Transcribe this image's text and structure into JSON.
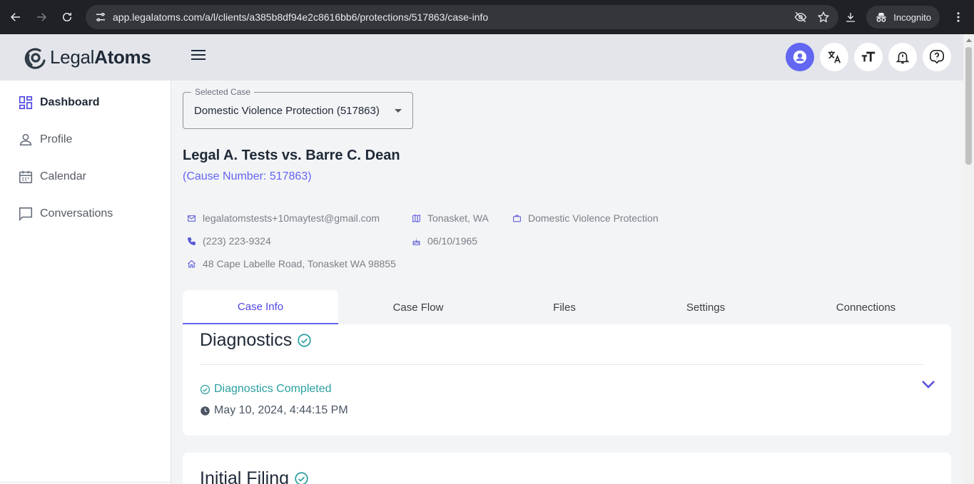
{
  "browser": {
    "url": "app.legalatoms.com/a/l/clients/a385b8df94e2c8616bb6/protections/517863/case-info",
    "incognito_label": "Incognito"
  },
  "sidebar": {
    "logo_prefix": "Legal",
    "logo_suffix": "Atoms",
    "items": [
      {
        "label": "Dashboard",
        "icon": "dashboard-icon",
        "active": true
      },
      {
        "label": "Profile",
        "icon": "person-icon",
        "active": false
      },
      {
        "label": "Calendar",
        "icon": "calendar-icon",
        "active": false
      },
      {
        "label": "Conversations",
        "icon": "chat-icon",
        "active": false
      }
    ]
  },
  "appbar": {
    "icons": [
      "account-icon",
      "translate-icon",
      "text-size-icon",
      "notification-icon",
      "help-icon"
    ],
    "accent": "#6366f1"
  },
  "case_select": {
    "label": "Selected Case",
    "value": "Domestic Violence Protection (517863)"
  },
  "case": {
    "title": "Legal A. Tests vs. Barre C. Dean",
    "cause_number": "(Cause Number: 517863)",
    "email": "legalatomstests+10maytest@gmail.com",
    "phone": "(223) 223-9324",
    "address": "48 Cape Labelle Road, Tonasket WA 98855",
    "city": "Tonasket, WA",
    "dob": "06/10/1965",
    "case_type": "Domestic Violence Protection"
  },
  "tabs": [
    {
      "label": "Case Info",
      "active": true
    },
    {
      "label": "Case Flow",
      "active": false
    },
    {
      "label": "Files",
      "active": false
    },
    {
      "label": "Settings",
      "active": false
    },
    {
      "label": "Connections",
      "active": false
    }
  ],
  "diagnostics": {
    "title": "Diagnostics",
    "status": "Diagnostics Completed",
    "timestamp": "May 10, 2024, 4:44:15 PM",
    "status_color": "#2a9fa0"
  },
  "initial_filing": {
    "title": "Initial Filing"
  }
}
